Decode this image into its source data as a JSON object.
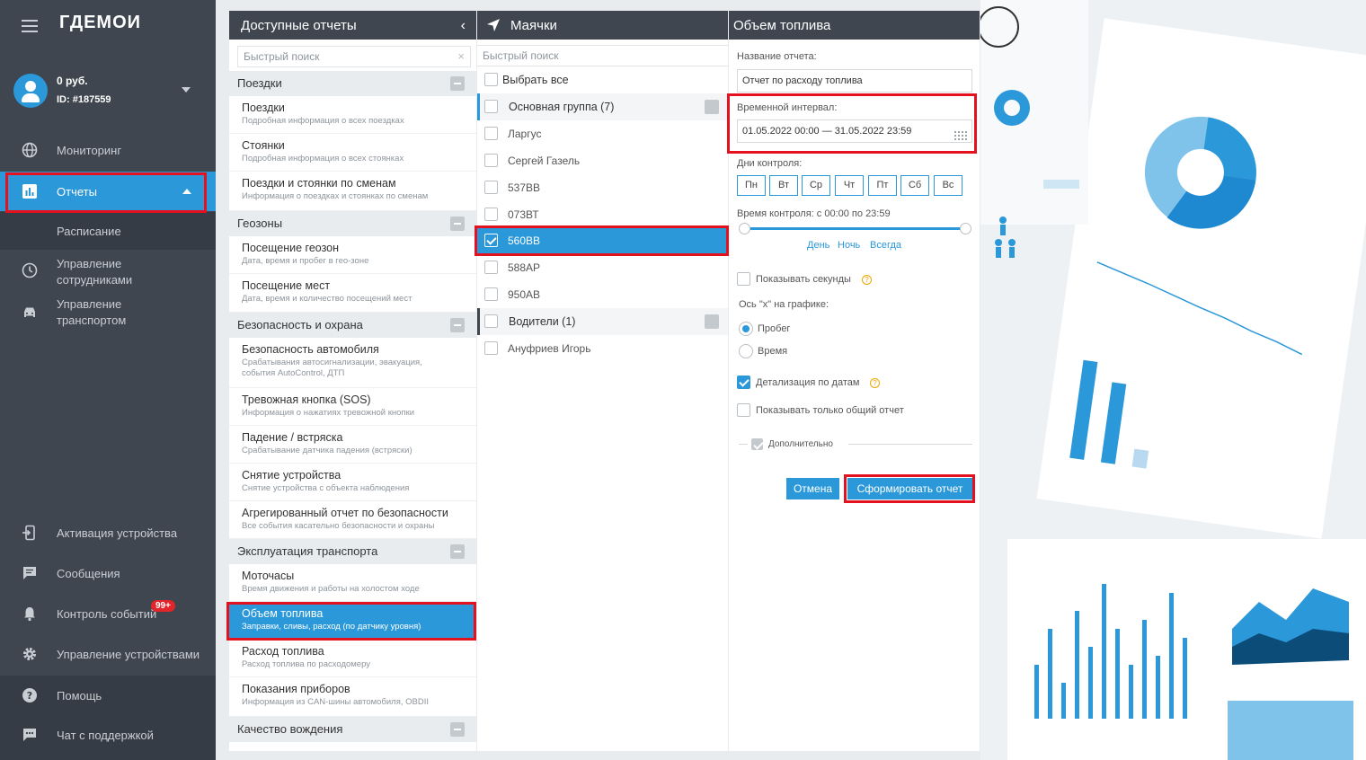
{
  "brand": {
    "logo": "ГДЕМОИ"
  },
  "account": {
    "balance": "0 руб.",
    "id": "ID: #187559"
  },
  "nav": {
    "monitoring": "Мониторинг",
    "reports": "Отчеты",
    "schedule": "Расписание",
    "staff": "Управление сотрудниками",
    "transport": "Управление транспортом",
    "activation": "Активация устройства",
    "messages": "Сообщения",
    "events": "Контроль событий",
    "events_badge": "99+",
    "devices": "Управление устройствами",
    "help": "Помощь",
    "support": "Чат с поддержкой"
  },
  "reports_panel": {
    "title": "Доступные отчеты",
    "search_placeholder": "Быстрый поиск",
    "categories": {
      "trips": "Поездки",
      "geozones": "Геозоны",
      "security": "Безопасность и охрана",
      "exploitation": "Эксплуатация транспорта",
      "driving": "Качество вождения"
    },
    "items": [
      {
        "title": "Поездки",
        "desc": "Подробная информация о всех поездках"
      },
      {
        "title": "Стоянки",
        "desc": "Подробная информация о всех стоянках"
      },
      {
        "title": "Поездки и стоянки по сменам",
        "desc": "Информация о поездках и стоянках по сменам"
      },
      {
        "title": "Посещение геозон",
        "desc": "Дата, время и пробег в гео-зоне"
      },
      {
        "title": "Посещение мест",
        "desc": "Дата, время и количество посещений мест"
      },
      {
        "title": "Безопасность автомобиля",
        "desc": "Срабатывания автосигнализации, эвакуация, события AutoControl, ДТП"
      },
      {
        "title": "Тревожная кнопка (SOS)",
        "desc": "Информация о нажатиях тревожной кнопки"
      },
      {
        "title": "Падение / встряска",
        "desc": "Срабатывание датчика падения (встряски)"
      },
      {
        "title": "Снятие устройства",
        "desc": "Снятие устройства с объекта наблюдения"
      },
      {
        "title": "Агрегированный отчет по безопасности",
        "desc": "Все события касательно безопасности и охраны"
      },
      {
        "title": "Моточасы",
        "desc": "Время движения и работы на холостом ходе"
      },
      {
        "title": "Объем топлива",
        "desc": "Заправки, сливы, расход (по датчику уровня)"
      },
      {
        "title": "Расход топлива",
        "desc": "Расход топлива по расходомеру"
      },
      {
        "title": "Показания приборов",
        "desc": "Информация из CAN-шины автомобиля, OBDII"
      }
    ]
  },
  "trackers_panel": {
    "title": "Маячки",
    "search_placeholder": "Быстрый поиск",
    "select_all": "Выбрать все",
    "group_main": "Основная группа (7)",
    "trackers": [
      "Ларгус",
      "Сергей Газель",
      "537ВВ",
      "073ВТ",
      "560ВВ",
      "588АР",
      "950АВ"
    ],
    "group_drivers": "Водители (1)",
    "drivers": [
      "Ануфриев Игорь"
    ]
  },
  "settings_panel": {
    "title": "Объем топлива",
    "name_label": "Название отчета:",
    "name_value": "Отчет по расходу топлива",
    "interval_label": "Временной интервал:",
    "interval_value": "01.05.2022 00:00 — 31.05.2022 23:59",
    "days_label": "Дни контроля:",
    "days": [
      "Пн",
      "Вт",
      "Ср",
      "Чт",
      "Пт",
      "Сб",
      "Вс"
    ],
    "time_label": "Время контроля: с 00:00 по 23:59",
    "time_links": [
      "День",
      "Ночь",
      "Всегда"
    ],
    "show_seconds": "Показывать секунды",
    "axis_label": "Ось \"x\" на графике:",
    "axis_mileage": "Пробег",
    "axis_time": "Время",
    "detail_dates": "Детализация по датам",
    "only_total": "Показывать только общий отчет",
    "additional": "Дополнительно",
    "cancel": "Отмена",
    "submit": "Сформировать отчет"
  },
  "colors": {
    "accent": "#2b98d9",
    "sidebar": "#3f4650",
    "highlight": "#e3121e"
  }
}
